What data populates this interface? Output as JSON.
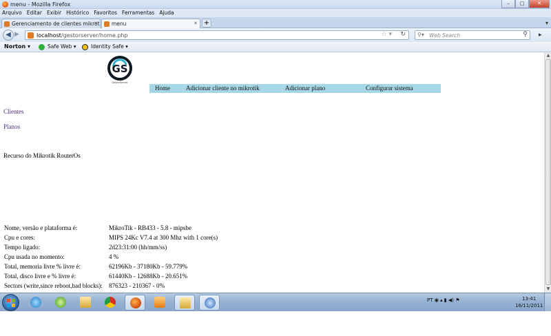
{
  "window": {
    "title": "menu - Mozilla Firefox",
    "buttons": [
      "–",
      "□",
      "✕"
    ]
  },
  "menubar": [
    "Arquivo",
    "Editar",
    "Exibir",
    "Histórico",
    "Favoritos",
    "Ferramentas",
    "Ajuda"
  ],
  "tabs": [
    {
      "label": "Gerenciamento de clientes mikrotik g...",
      "active": false
    },
    {
      "label": "menu",
      "active": true
    }
  ],
  "nav": {
    "url_host": "localhost",
    "url_path": "/gestorserver/home.php",
    "search_placeholder": "Web Search"
  },
  "norton": {
    "brand": "Norton",
    "safe_web": "Safe Web",
    "identity_safe": "Identity Safe"
  },
  "page": {
    "logo_text": "GS",
    "logo_caption": "GestorServer",
    "top_menu": [
      "Home",
      "Adicionar cliente no mikrotik",
      "Adicionar plano",
      "Configurar sistema"
    ],
    "side_links": [
      "Clientes",
      "Planos"
    ],
    "section_title": "Recurso do Mikrotik RouterOs",
    "info": [
      {
        "label": "Nome, versão e plataforma é:",
        "value": "MikroTik - RB433 - 5.8 - mipsbe"
      },
      {
        "label": "Cpu e cores:",
        "value": "MIPS 24Kc V7.4 at 300 Mhz with 1 core(s)"
      },
      {
        "label": "Tempo ligado:",
        "value": "2d23:31:00 (hh/mm/ss)"
      },
      {
        "label": "Cpu usada no momento:",
        "value": "4 %"
      },
      {
        "label": "Total, memoria livre % livre é:",
        "value": "62196Kb - 37180Kb - 59.779%"
      },
      {
        "label": "Total, disco livre e % livre é:",
        "value": "61440Kb - 12688Kb - 20.651%"
      },
      {
        "label": "Sectors (write,since reboot,bad blocks):",
        "value": "876323 - 210367 - 0%"
      }
    ]
  },
  "taskbar": {
    "lang": "PT",
    "time": "13:41",
    "date": "16/11/2011"
  },
  "colors": {
    "menu_bar": "#a7d7e7",
    "link": "#4b2a79"
  }
}
